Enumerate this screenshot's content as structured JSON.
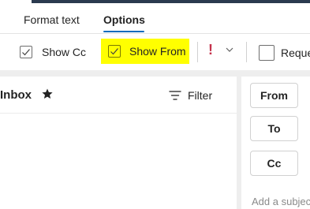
{
  "tabs": {
    "format_text": "Format text",
    "options": "Options"
  },
  "ribbon": {
    "show_cc": "Show Cc",
    "show_from": "Show From",
    "request_partial": "Reque"
  },
  "inbox": {
    "title": "Inbox",
    "filter": "Filter"
  },
  "compose": {
    "from_btn": "From",
    "to_btn": "To",
    "cc_btn": "Cc",
    "subject_placeholder": "Add a subject"
  },
  "colors": {
    "highlight": "#ffff00",
    "accent": "#0f6cbd",
    "importance": "#c4314b"
  }
}
